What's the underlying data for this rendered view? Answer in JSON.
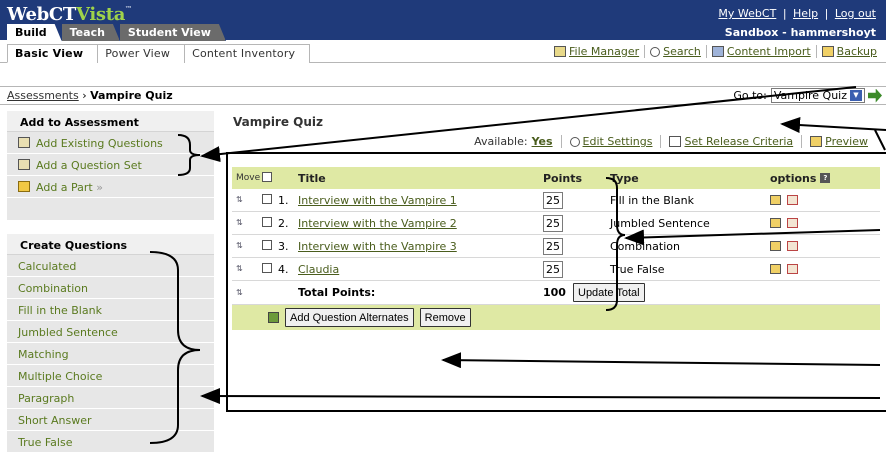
{
  "header": {
    "logo_main": "WebCT",
    "logo_accent": "Vista",
    "logo_tm": "™",
    "links": [
      "My WebCT",
      "Help",
      "Log out"
    ],
    "link_sep": "|",
    "context": "Sandbox - hammershoyt",
    "colors": {
      "bar": "#1f3a7a",
      "accent": "#9fd34a"
    }
  },
  "top_tabs": [
    {
      "label": "Build",
      "active": true
    },
    {
      "label": "Teach",
      "active": false
    },
    {
      "label": "Student View",
      "active": false
    }
  ],
  "sub_tabs": [
    {
      "label": "Basic View",
      "active": true
    },
    {
      "label": "Power View",
      "active": false
    },
    {
      "label": "Content Inventory",
      "active": false
    }
  ],
  "tools": [
    {
      "label": "File Manager",
      "icon": "file-manager-icon"
    },
    {
      "label": "Search",
      "icon": "search-icon"
    },
    {
      "label": "Content Import",
      "icon": "content-import-icon"
    },
    {
      "label": "Backup",
      "icon": "backup-icon"
    }
  ],
  "breadcrumb": {
    "parent": "Assessments",
    "sep": "›",
    "current": "Vampire Quiz"
  },
  "goto": {
    "label": "Go to:",
    "selected": "Vampire Quiz"
  },
  "sidebar": {
    "add_heading": "Add to Assessment",
    "add_items": [
      {
        "label": "Add Existing Questions",
        "icon": "existing-questions-icon"
      },
      {
        "label": "Add a Question Set",
        "icon": "question-set-icon"
      },
      {
        "label": "Add a Part",
        "icon": "folder-icon",
        "suffix": "»"
      }
    ],
    "create_heading": "Create Questions",
    "create_items": [
      "Calculated",
      "Combination",
      "Fill in the Blank",
      "Jumbled Sentence",
      "Matching",
      "Multiple Choice",
      "Paragraph",
      "Short Answer",
      "True False"
    ]
  },
  "main": {
    "title": "Vampire Quiz",
    "available_label": "Available:",
    "available_value": "Yes",
    "edit_settings": "Edit Settings",
    "release_criteria": "Set Release Criteria",
    "preview": "Preview"
  },
  "table": {
    "columns": {
      "move": "Move",
      "title": "Title",
      "points": "Points",
      "type": "Type",
      "options": "options"
    },
    "rows": [
      {
        "num": "1.",
        "title": "Interview with the Vampire 1",
        "points": "25",
        "type": "Fill in the Blank"
      },
      {
        "num": "2.",
        "title": "Interview with the Vampire 2",
        "points": "25",
        "type": "Jumbled Sentence"
      },
      {
        "num": "3.",
        "title": "Interview with the Vampire 3",
        "points": "25",
        "type": "Combination"
      },
      {
        "num": "4.",
        "title": "Claudia",
        "points": "25",
        "type": "True False"
      }
    ],
    "total_label": "Total Points:",
    "total_value": "100",
    "update_button": "Update Total",
    "add_alternates_button": "Add Question Alternates",
    "remove_button": "Remove"
  }
}
